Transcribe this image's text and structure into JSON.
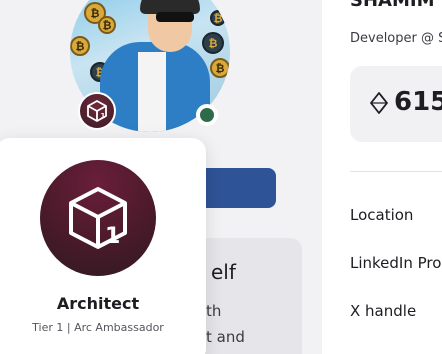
{
  "profile": {
    "name": "SHAMIM",
    "role": "Developer @ S",
    "points": "615",
    "points_icon": "diamond-icon",
    "avatar_image": "avatar"
  },
  "tier_badge": {
    "icon": "cube-icon",
    "tier_number": "1",
    "title": "Architect",
    "subtitle": "Tier 1 | Arc Ambassador",
    "colors": {
      "outer": "#2f1a20",
      "inner": "#6a1e3a"
    }
  },
  "about": {
    "title": "elf",
    "text_lines": [
      "th",
      "t and"
    ]
  },
  "info_rows": [
    {
      "label": "Location"
    },
    {
      "label": "LinkedIn Pro"
    },
    {
      "label": "X handle"
    }
  ],
  "colors": {
    "accent_button": "#2f5397",
    "online": "#2f6b4b"
  }
}
